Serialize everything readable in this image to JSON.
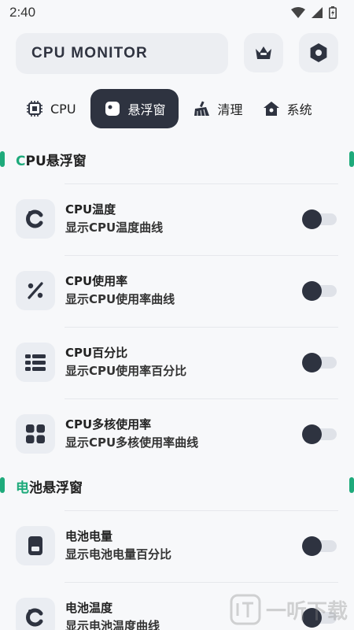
{
  "status_bar": {
    "time": "2:40"
  },
  "header": {
    "title": "CPU MONITOR"
  },
  "tabs": [
    {
      "label": "CPU",
      "icon": "chip-icon",
      "active": false
    },
    {
      "label": "悬浮窗",
      "icon": "float-window-icon",
      "active": true
    },
    {
      "label": "清理",
      "icon": "broom-icon",
      "active": false
    },
    {
      "label": "系统",
      "icon": "house-icon",
      "active": false
    }
  ],
  "sections": [
    {
      "accent": "C",
      "rest": "PU悬浮窗",
      "items": [
        {
          "title": "CPU温度",
          "subtitle": "显示CPU温度曲线",
          "icon": "c-letter-icon"
        },
        {
          "title": "CPU使用率",
          "subtitle": "显示CPU使用率曲线",
          "icon": "percent-icon"
        },
        {
          "title": "CPU百分比",
          "subtitle": "显示CPU使用率百分比",
          "icon": "bar-grid-icon"
        },
        {
          "title": "CPU多核使用率",
          "subtitle": "显示CPU多核使用率曲线",
          "icon": "four-squares-icon"
        }
      ]
    },
    {
      "accent": "电",
      "rest": "池悬浮窗",
      "items": [
        {
          "title": "电池电量",
          "subtitle": "显示电池电量百分比",
          "icon": "battery-card-icon"
        },
        {
          "title": "电池温度",
          "subtitle": "显示电池温度曲线",
          "icon": "c-letter-icon"
        }
      ]
    }
  ],
  "watermark": {
    "text": "一听下载"
  },
  "colors": {
    "accent": "#1eaa7b",
    "dark": "#2e3340",
    "background": "#f7f8fa"
  }
}
